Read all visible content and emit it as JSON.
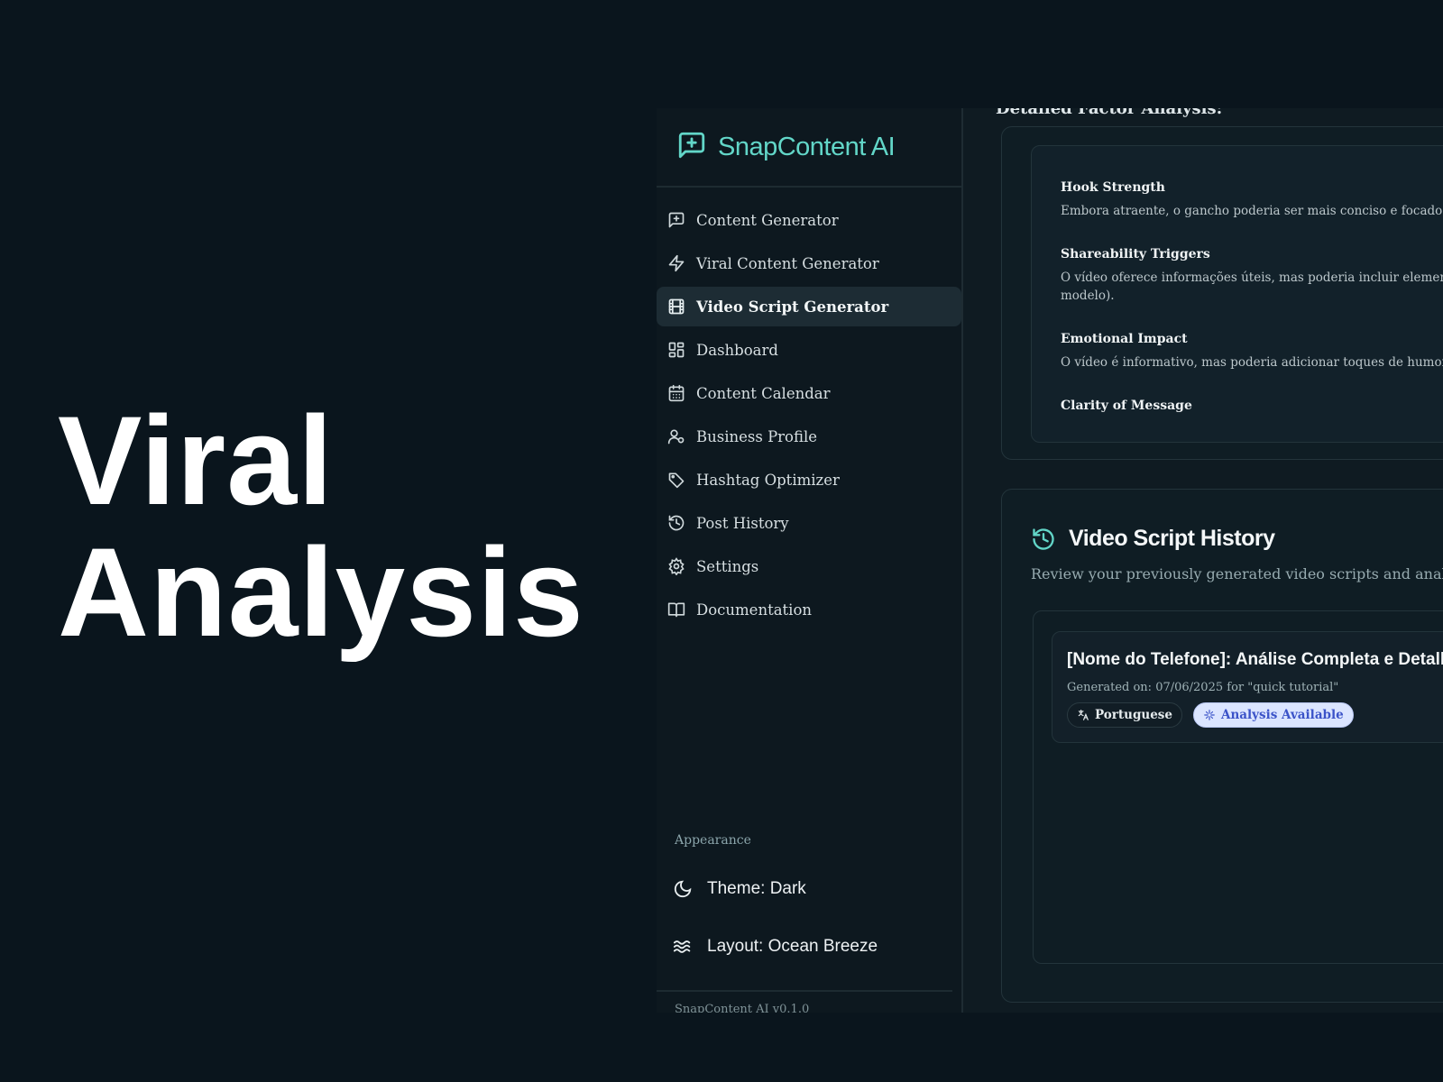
{
  "hero": {
    "line1": "Viral",
    "line2": "Analysis"
  },
  "brand": {
    "name": "SnapContent AI"
  },
  "nav": [
    {
      "label": "Content Generator",
      "icon": "message-plus-icon"
    },
    {
      "label": "Viral Content Generator",
      "icon": "lightning-icon"
    },
    {
      "label": "Video Script Generator",
      "icon": "film-icon",
      "active": true
    },
    {
      "label": "Dashboard",
      "icon": "grid-icon"
    },
    {
      "label": "Content Calendar",
      "icon": "calendar-icon"
    },
    {
      "label": "Business Profile",
      "icon": "user-gear-icon"
    },
    {
      "label": "Hashtag Optimizer",
      "icon": "tag-icon"
    },
    {
      "label": "Post History",
      "icon": "history-icon"
    },
    {
      "label": "Settings",
      "icon": "gear-icon"
    },
    {
      "label": "Documentation",
      "icon": "book-icon"
    }
  ],
  "appearance": {
    "label": "Appearance",
    "theme": "Theme: Dark",
    "layout": "Layout: Ocean Breeze",
    "version": "SnapContent AI v0.1.0"
  },
  "factors": {
    "section_title": "Detailed Factor Analysis:",
    "items": [
      {
        "title": "Hook Strength",
        "text": "Embora atraente, o gancho poderia ser mais conciso e focado nos"
      },
      {
        "title": "Shareability Triggers",
        "text": "O vídeo oferece informações úteis, mas poderia incluir elementos\nmodelo)."
      },
      {
        "title": "Emotional Impact",
        "text": "O vídeo é informativo, mas poderia adicionar toques de humor ou"
      },
      {
        "title": "Clarity of Message",
        "text": ""
      }
    ]
  },
  "history": {
    "title": "Video Script History",
    "subtitle": "Review your previously generated video scripts and analyses",
    "items": [
      {
        "title": "[Nome do Telefone]: Análise Completa e Detalha",
        "meta": "Generated on: 07/06/2025 for \"quick tutorial\"",
        "language": "Portuguese",
        "badge": "Analysis Available"
      }
    ]
  },
  "colors": {
    "accent": "#62d6c8",
    "background": "#0a151d",
    "badge": "#dbe5ff"
  }
}
